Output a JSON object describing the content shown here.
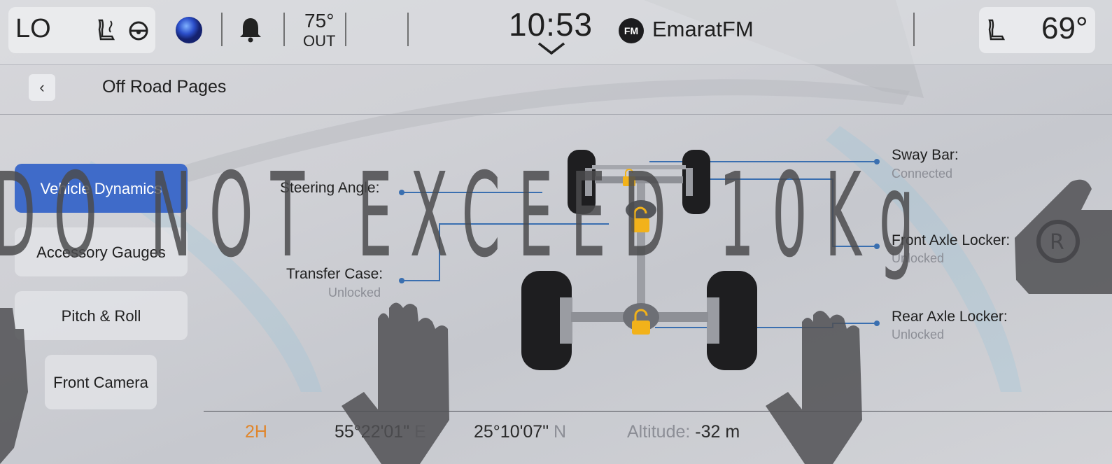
{
  "status_bar": {
    "climate_left": "LO",
    "outside_temp": "75°",
    "outside_label": "OUT",
    "clock": "10:53",
    "radio_badge": "FM",
    "station": "EmaratFM",
    "climate_right": "69°"
  },
  "header": {
    "title": "Off Road Pages"
  },
  "nav": {
    "items": [
      {
        "label": "Vehicle Dynamics",
        "active": true
      },
      {
        "label": "Accessory Gauges",
        "active": false
      },
      {
        "label": "Pitch & Roll",
        "active": false
      },
      {
        "label": "Front Camera",
        "active": false
      }
    ]
  },
  "vehicle_diagram": {
    "steering_angle": {
      "title": "Steering Angle:",
      "value": ""
    },
    "transfer_case": {
      "title": "Transfer Case:",
      "value": "Unlocked"
    },
    "sway_bar": {
      "title": "Sway Bar:",
      "value": "Connected"
    },
    "front_axle_locker": {
      "title": "Front Axle Locker:",
      "value": "Unlocked"
    },
    "rear_axle_locker": {
      "title": "Rear Axle Locker:",
      "value": "Unlocked"
    }
  },
  "footer": {
    "drive_mode": "2H",
    "longitude": "55°22'01\"",
    "longitude_dir": "E",
    "latitude": "25°10'07\"",
    "latitude_dir": "N",
    "altitude_label": "Altitude:",
    "altitude_value": "-32 m"
  },
  "watermark": {
    "text": "DO NOT EXCEED 10Kg"
  },
  "colors": {
    "active_nav": "#3f6bc9",
    "drive_mode": "#e0862c",
    "lock_icon": "#f2b21a",
    "callout_line": "#3a6fb0"
  }
}
